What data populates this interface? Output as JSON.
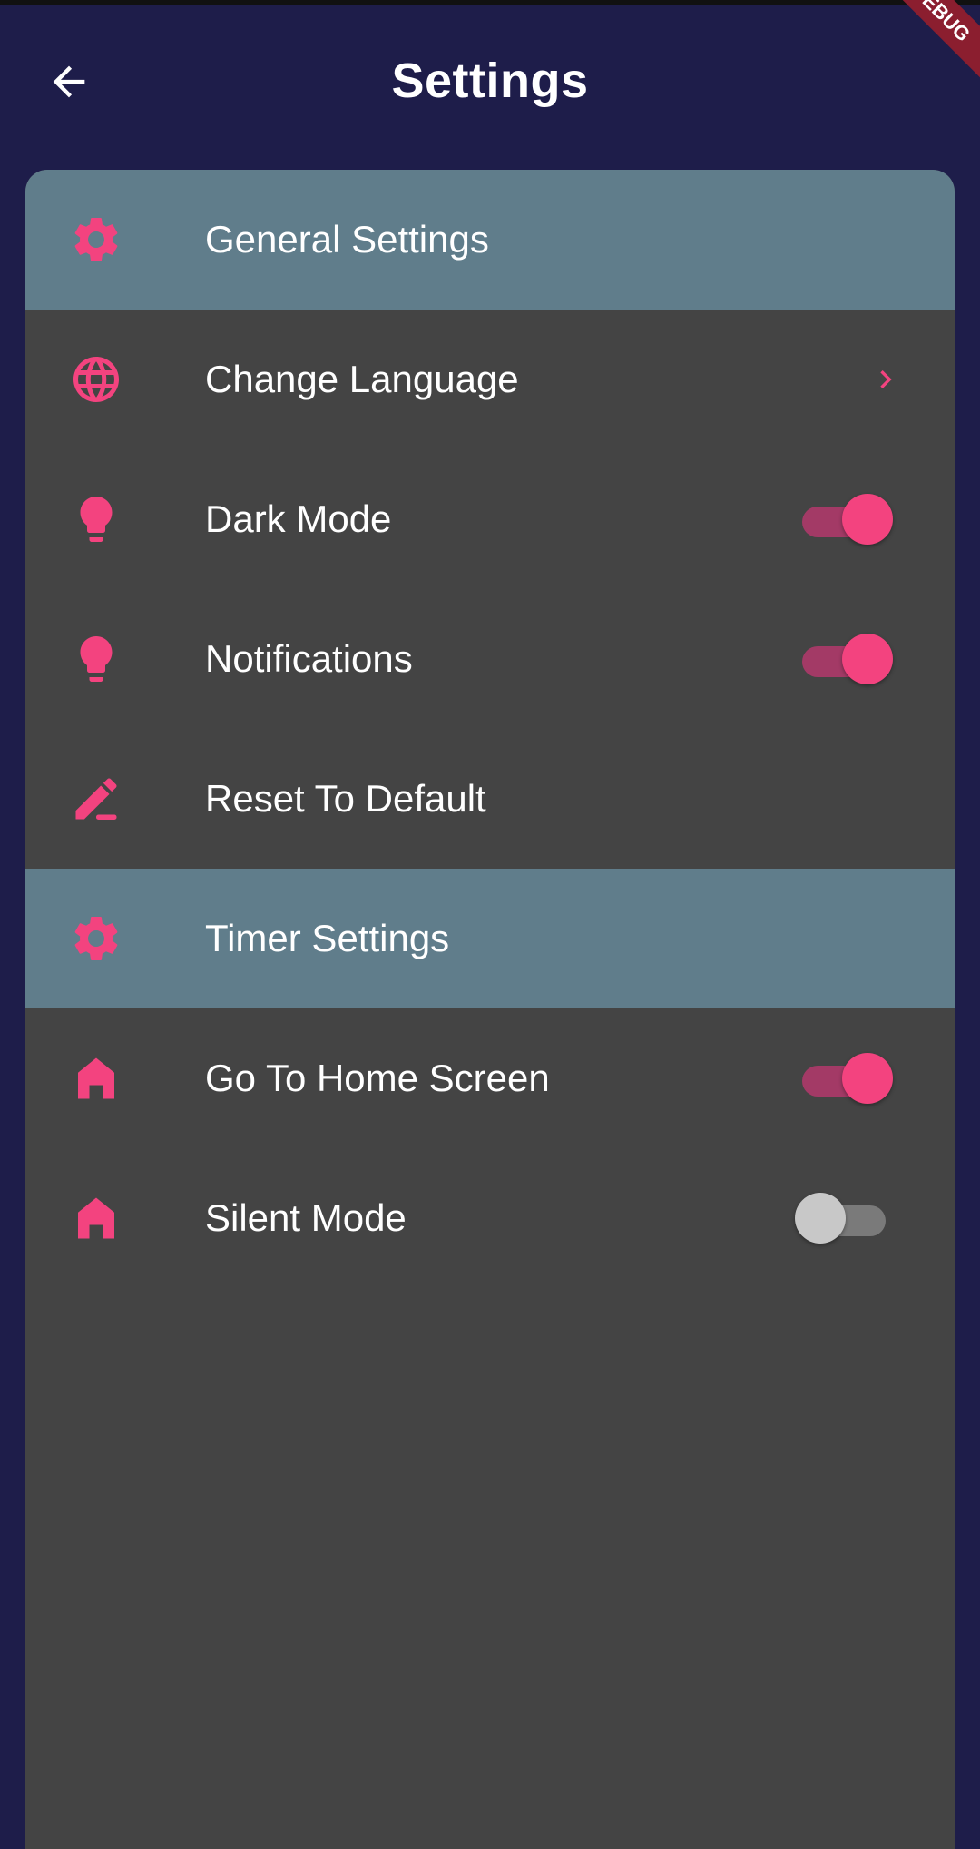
{
  "appbar": {
    "title": "Settings",
    "back_icon": "arrow-back-icon",
    "debug_banner": "DEBUG"
  },
  "colors": {
    "background": "#1e1d4a",
    "panel": "#444444",
    "section_header": "#607d8b",
    "accent": "#f3437f"
  },
  "sections": [
    {
      "header": {
        "label": "General Settings",
        "icon": "gear-icon"
      },
      "items": [
        {
          "label": "Change Language",
          "icon": "globe-icon",
          "trailing": "chevron-right-icon"
        },
        {
          "label": "Dark Mode",
          "icon": "lightbulb-icon",
          "toggle": true
        },
        {
          "label": "Notifications",
          "icon": "lightbulb-icon",
          "toggle": true
        },
        {
          "label": "Reset To Default",
          "icon": "edit-icon"
        }
      ]
    },
    {
      "header": {
        "label": "Timer Settings",
        "icon": "gear-icon"
      },
      "items": [
        {
          "label": "Go To Home Screen",
          "icon": "home-icon",
          "toggle": true
        },
        {
          "label": "Silent Mode",
          "icon": "home-icon",
          "toggle": false
        }
      ]
    }
  ]
}
